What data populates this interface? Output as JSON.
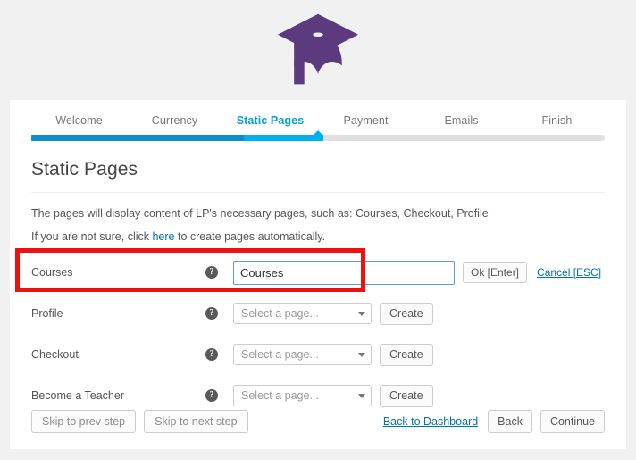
{
  "logo": {
    "icon": "graduation-cap-icon",
    "color": "#5b3a7e"
  },
  "wizard": {
    "steps": [
      {
        "label": "Welcome",
        "state": "done"
      },
      {
        "label": "Currency",
        "state": "done"
      },
      {
        "label": "Static Pages",
        "state": "active"
      },
      {
        "label": "Payment",
        "state": "upcoming"
      },
      {
        "label": "Emails",
        "state": "upcoming"
      },
      {
        "label": "Finish",
        "state": "upcoming"
      }
    ],
    "progress": {
      "done_percent": 37,
      "current_percent": 51,
      "marker_percent": 50,
      "done_color": "#0c8ec9",
      "current_color": "#00b0f0",
      "track_color": "#e0e0e0"
    }
  },
  "page": {
    "title": "Static Pages",
    "description_line1": "The pages will display content of LP's necessary pages, such as: Courses, Checkout, Profile",
    "description_line2_before": "If you are not sure, click ",
    "description_line2_link": "here",
    "description_line2_after": " to create pages automatically."
  },
  "rows": [
    {
      "label": "Courses",
      "help_icon": "question-mark-icon",
      "mode": "editing",
      "input_value": "Courses",
      "input_placeholder": "",
      "ok_label": "Ok [Enter]",
      "cancel_label": "Cancel [ESC]"
    },
    {
      "label": "Profile",
      "help_icon": "question-mark-icon",
      "mode": "select",
      "select_value": "Select a page...",
      "create_label": "Create"
    },
    {
      "label": "Checkout",
      "help_icon": "question-mark-icon",
      "mode": "select",
      "select_value": "Select a page...",
      "create_label": "Create"
    },
    {
      "label": "Become a Teacher",
      "help_icon": "question-mark-icon",
      "mode": "select",
      "select_value": "Select a page...",
      "create_label": "Create"
    }
  ],
  "footer": {
    "skip_prev_label": "Skip to prev step",
    "skip_next_label": "Skip to next step",
    "dashboard_link": "Back to Dashboard",
    "back_label": "Back",
    "continue_label": "Continue"
  },
  "annotation": {
    "type": "highlight-rectangle",
    "color": "#ee1111"
  }
}
